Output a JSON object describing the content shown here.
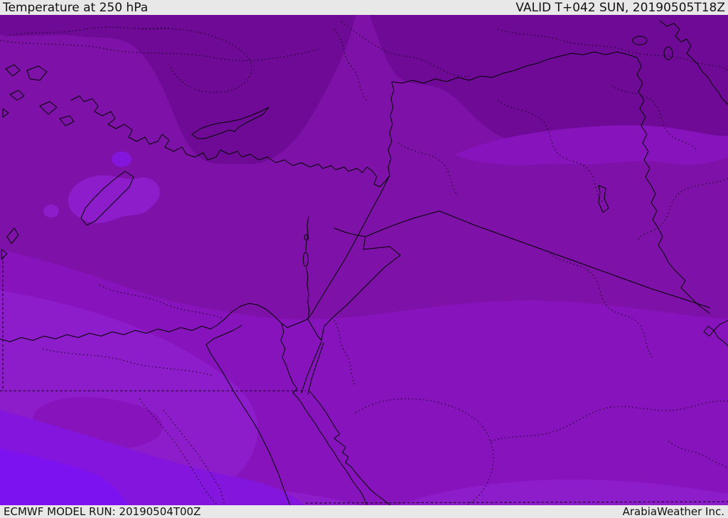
{
  "header": {
    "title": "Temperature at 250 hPa",
    "validity": "VALID T+042 SUN, 20190505T18Z"
  },
  "footer": {
    "model_run": "ECMWF MODEL RUN: 20190504T00Z",
    "credit": "ArabiaWeather Inc."
  },
  "map": {
    "parameter": "Temperature",
    "pressure_level": "250 hPa",
    "model": "ECMWF",
    "forecast_step": "T+042",
    "valid_time": "20190505T18Z",
    "run_time": "20190504T00Z"
  },
  "colors": {
    "chrome-bg": "#e8e8e8",
    "chrome-text": "#121212",
    "temp-dark": "#6e0a95",
    "temp-medium": "#7e11a7",
    "temp-base-south": "#8713bc",
    "temp-bright": "#8d1ccb",
    "temp-violet": "#8315dc",
    "temp-violet-bright": "#7c12ef",
    "line-solid": "#000000"
  }
}
